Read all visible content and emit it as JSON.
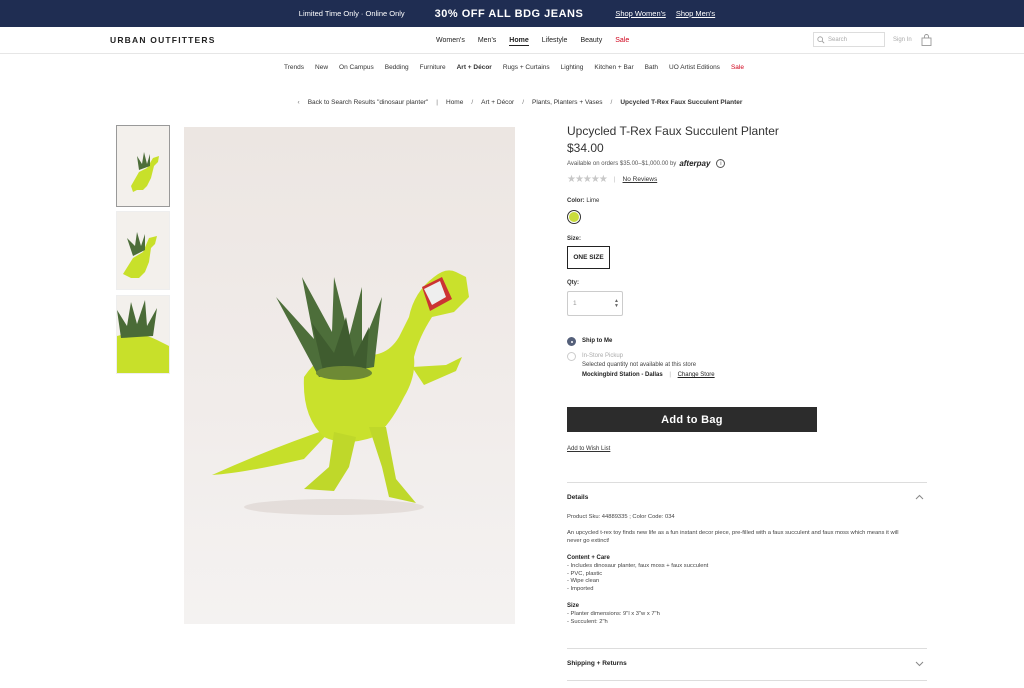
{
  "promo": {
    "small": "Limited Time Only · Online Only",
    "headline": "30% OFF ALL BDG JEANS",
    "links": [
      "Shop Women's",
      "Shop Men's"
    ],
    "bg_color": "#1f2d52"
  },
  "header": {
    "logo": "URBAN OUTFITTERS",
    "nav": [
      "Women's",
      "Men's",
      "Home",
      "Lifestyle",
      "Beauty",
      "Sale"
    ],
    "active_nav": "Home",
    "search_placeholder": "Search",
    "signin": "Sign In",
    "bag_icon": "shopping-bag-icon"
  },
  "subnav": [
    "Trends",
    "New",
    "On Campus",
    "Bedding",
    "Furniture",
    "Art + Décor",
    "Rugs + Curtains",
    "Lighting",
    "Kitchen + Bar",
    "Bath",
    "UO Artist Editions",
    "Sale"
  ],
  "breadcrumb": {
    "back": "Back to Search Results \"dinosaur planter\"",
    "items": [
      "Home",
      "Art + Décor",
      "Plants, Planters + Vases",
      "Upcycled T-Rex Faux Succulent Planter"
    ]
  },
  "product": {
    "title": "Upcycled T-Rex Faux Succulent Planter",
    "price": "$34.00",
    "afterpay_text": "Available on orders $35.00–$1,000.00 by",
    "afterpay_brand": "afterpay",
    "rating_stars": 0,
    "reviews_link": "No Reviews",
    "color_label": "Color:",
    "color_value": "Lime",
    "color_hex": "#c9dc3c",
    "size_label": "Size:",
    "size_value": "ONE SIZE",
    "qty_label": "Qty:",
    "qty_value": "1",
    "ship_label": "Ship to Me",
    "pickup_label": "In-Store Pickup",
    "pickup_note": "Selected quantity not available at this store",
    "store_name": "Mockingbird Station - Dallas",
    "change_store": "Change Store",
    "add_to_bag": "Add to Bag",
    "wish_list": "Add to Wish List"
  },
  "details": {
    "heading": "Details",
    "sku_line": "Product Sku: 44889335 ; Color Code: 034",
    "description": "An upcycled t-rex toy finds new life as a fun instant decor piece, pre-filled with a faux succulent and faux moss which means it will never go extinct!",
    "care_heading": "Content + Care",
    "care_items": [
      "- Includes dinosaur planter, faux moss + faux succulent",
      "- PVC, plastic",
      "- Wipe clean",
      "- Imported"
    ],
    "size_heading": "Size",
    "size_items": [
      "- Planter dimensions: 9\"l x 3\"w x 7\"h",
      "- Succulent: 2\"h"
    ]
  },
  "shipping": {
    "heading": "Shipping + Returns"
  }
}
